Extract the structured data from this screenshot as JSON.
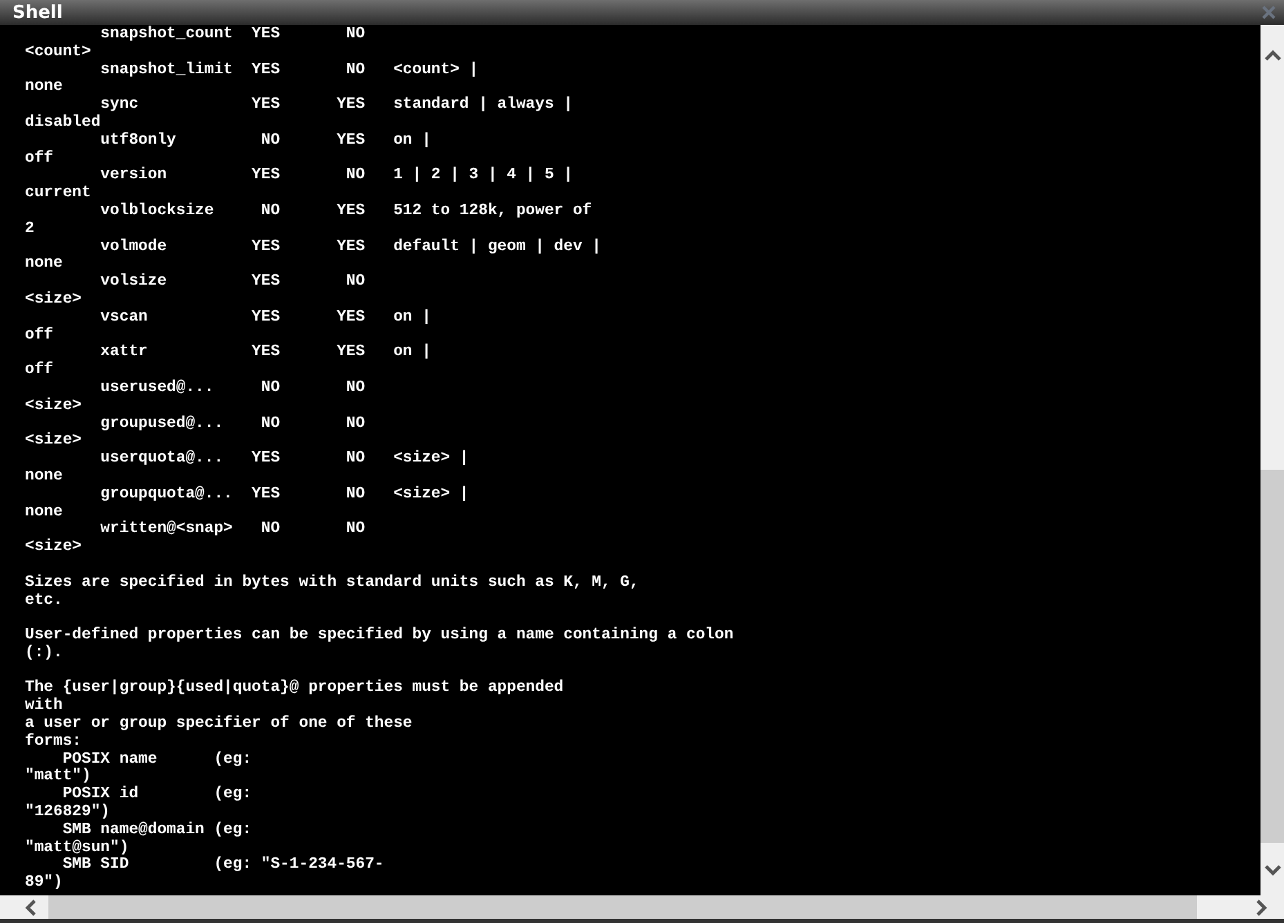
{
  "window": {
    "title": "Shell"
  },
  "terminal": {
    "blocks": [
      [
        "        snapshot_count  YES       NO",
        "<count>",
        "        snapshot_limit  YES       NO   <count> |",
        "none",
        "        sync            YES      YES   standard | always |",
        "disabled",
        "        utf8only         NO      YES   on |",
        "off",
        "        version         YES       NO   1 | 2 | 3 | 4 | 5 |",
        "current",
        "        volblocksize     NO      YES   512 to 128k, power of",
        "2",
        "        volmode         YES      YES   default | geom | dev |",
        "none",
        "        volsize         YES       NO",
        "<size>",
        "        vscan           YES      YES   on |",
        "off",
        "        xattr           YES      YES   on |",
        "off",
        "        userused@...     NO       NO",
        "<size>",
        "        groupused@...    NO       NO",
        "<size>",
        "        userquota@...   YES       NO   <size> |",
        "none",
        "        groupquota@...  YES       NO   <size> |",
        "none",
        "        written@<snap>   NO       NO",
        "<size>"
      ],
      [
        "Sizes are specified in bytes with standard units such as K, M, G,",
        "etc."
      ],
      [
        "User-defined properties can be specified by using a name containing a colon",
        "(:)."
      ],
      [
        "The {user|group}{used|quota}@ properties must be appended",
        "with",
        "a user or group specifier of one of these",
        "forms:",
        "    POSIX name      (eg:",
        "\"matt\")",
        "    POSIX id        (eg:",
        "\"126829\")",
        "    SMB name@domain (eg:",
        "\"matt@sun\")",
        "    SMB SID         (eg: \"S-1-234-567-",
        "89\")"
      ]
    ]
  }
}
